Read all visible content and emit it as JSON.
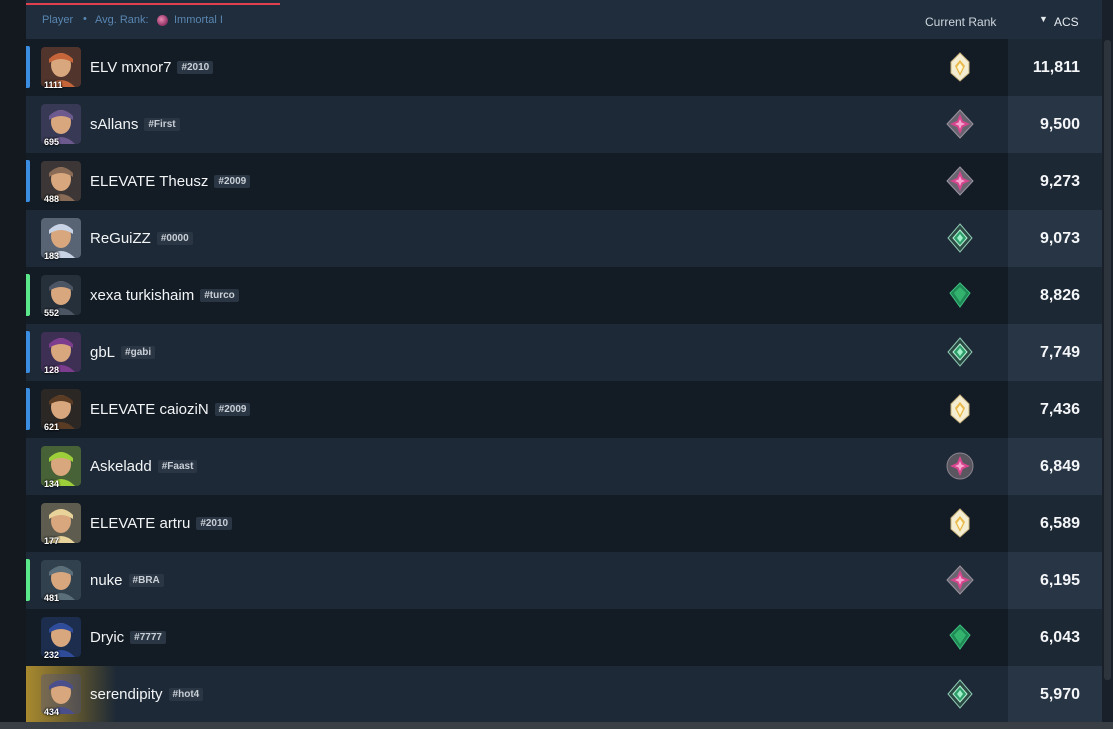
{
  "header": {
    "player_label": "Player",
    "separator": "•",
    "avg_rank_label": "Avg. Rank:",
    "avg_rank_value": "Immortal I",
    "avg_rank_icon": "immortal-rank-icon",
    "current_rank_label": "Current Rank",
    "sort_icon": "sort-desc-icon",
    "sort_glyph": "▼",
    "acs_label": "ACS"
  },
  "colors": {
    "accent_red": "#e0404d",
    "party_blue": "#3a8de0",
    "party_green": "#5be88a",
    "highlight_gold": "#a98a2f"
  },
  "players": [
    {
      "name": "ELV mxnor7",
      "tag": "#2010",
      "level": "1111",
      "rank": "radiant",
      "acs": "11,811",
      "party": "blue",
      "avatar": "#c7653a"
    },
    {
      "name": "sAllans",
      "tag": "#First",
      "level": "695",
      "rank": "immortal",
      "acs": "9,500",
      "party": "",
      "avatar": "#6c5a8e"
    },
    {
      "name": "ELEVATE Theusz",
      "tag": "#2009",
      "level": "488",
      "rank": "immortal",
      "acs": "9,273",
      "party": "blue",
      "avatar": "#8a6b55"
    },
    {
      "name": "ReGuiZZ",
      "tag": "#0000",
      "level": "183",
      "rank": "ascendant",
      "acs": "9,073",
      "party": "",
      "avatar": "#c9d3e6"
    },
    {
      "name": "xexa turkishaim",
      "tag": "#turco",
      "level": "552",
      "rank": "ascendant-solid",
      "acs": "8,826",
      "party": "green",
      "avatar": "#4b5563"
    },
    {
      "name": "gbL",
      "tag": "#gabi",
      "level": "128",
      "rank": "ascendant",
      "acs": "7,749",
      "party": "blue",
      "avatar": "#7d3d8f"
    },
    {
      "name": "ELEVATE caioziN",
      "tag": "#2009",
      "level": "621",
      "rank": "radiant",
      "acs": "7,436",
      "party": "blue",
      "avatar": "#5a3b24"
    },
    {
      "name": "Askeladd",
      "tag": "#Faast",
      "level": "134",
      "rank": "immortal-round",
      "acs": "6,849",
      "party": "",
      "avatar": "#9ccf3a"
    },
    {
      "name": "ELEVATE artru",
      "tag": "#2010",
      "level": "177",
      "rank": "radiant",
      "acs": "6,589",
      "party": "",
      "avatar": "#e8d39a"
    },
    {
      "name": "nuke",
      "tag": "#BRA",
      "level": "481",
      "rank": "immortal",
      "acs": "6,195",
      "party": "green",
      "avatar": "#5b6f7a"
    },
    {
      "name": "Dryic",
      "tag": "#7777",
      "level": "232",
      "rank": "ascendant-solid",
      "acs": "6,043",
      "party": "",
      "avatar": "#2f4c9a"
    },
    {
      "name": "serendipity",
      "tag": "#hot4",
      "level": "434",
      "rank": "ascendant",
      "acs": "5,970",
      "party": "",
      "avatar": "#4a4f8c",
      "highlight": true
    }
  ]
}
